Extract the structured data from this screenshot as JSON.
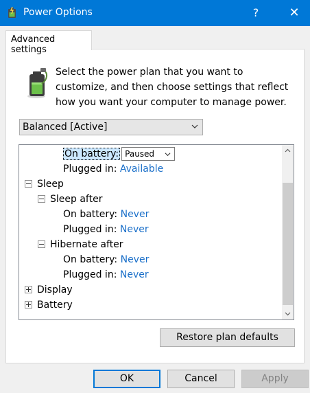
{
  "window": {
    "title": "Power Options",
    "help_label": "?",
    "close_label": "✕"
  },
  "tabs": [
    {
      "label": "Advanced settings"
    }
  ],
  "description": "Select the power plan that you want to customize, and then choose settings that reflect how you want your computer to manage power.",
  "plan_select": {
    "value": "Balanced [Active]"
  },
  "tree": {
    "items": [
      {
        "label": "On battery:",
        "value": "Paused"
      },
      {
        "label": "Plugged in:",
        "value": "Available"
      },
      {
        "label": "Sleep"
      },
      {
        "label": "Sleep after"
      },
      {
        "label": "On battery:",
        "value": "Never"
      },
      {
        "label": "Plugged in:",
        "value": "Never"
      },
      {
        "label": "Hibernate after"
      },
      {
        "label": "On battery:",
        "value": "Never"
      },
      {
        "label": "Plugged in:",
        "value": "Never"
      },
      {
        "label": "Display"
      },
      {
        "label": "Battery"
      }
    ]
  },
  "buttons": {
    "restore": "Restore plan defaults",
    "ok": "OK",
    "cancel": "Cancel",
    "apply": "Apply"
  },
  "colors": {
    "accent": "#0078d7",
    "link": "#1a6fc9",
    "selection": "#cce8ff"
  }
}
